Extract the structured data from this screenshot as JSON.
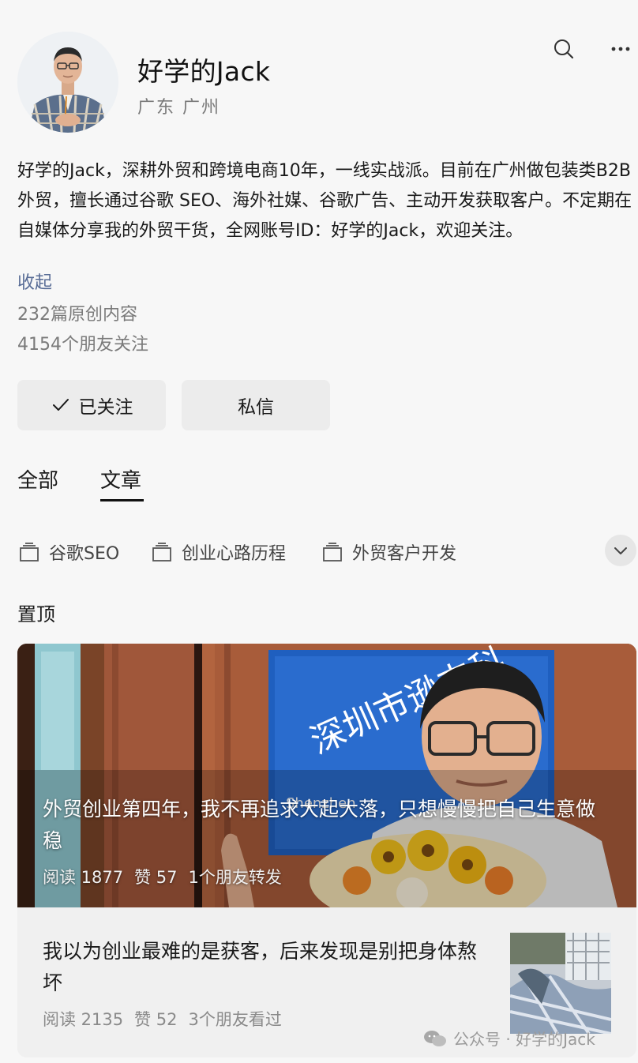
{
  "profile": {
    "name": "好学的Jack",
    "location": "广东  广州",
    "bio": "好学的Jack，深耕外贸和跨境电商10年，一线实战派。目前在广州做包装类B2B外贸，擅长通过谷歌 SEO、海外社媒、谷歌广告、主动开发获取客户。不定期在自媒体分享我的外贸干货，全网账号ID：好学的Jack，欢迎关注。",
    "collapse_label": "收起",
    "original_count": "232篇原创内容",
    "friends_following": "4154个朋友关注"
  },
  "header_icons": [
    "search-icon",
    "more-icon"
  ],
  "actions": {
    "follow_label": "已关注",
    "message_label": "私信"
  },
  "tabs": [
    {
      "label": "全部",
      "active": false
    },
    {
      "label": "文章",
      "active": true
    }
  ],
  "collections": [
    {
      "label": "谷歌SEO",
      "icon": "collection-icon"
    },
    {
      "label": "创业心路历程",
      "icon": "collection-icon"
    },
    {
      "label": "外贸客户开发",
      "icon": "collection-icon"
    }
  ],
  "pinned": {
    "label": "置顶",
    "cover_article": {
      "title": "外贸创业第四年，我不再追求大起大落，只想慢慢把自己生意做稳",
      "reads": "阅读 1877",
      "likes": "赞 57",
      "shares": "1个朋友转发",
      "sign_text": "深圳市逊杰科",
      "sign_sub": "Shenzhen"
    },
    "second_article": {
      "title": "我以为创业最难的是获客，后来发现是别把身体熬坏",
      "reads": "阅读 2135",
      "likes": "赞 52",
      "viewed": "3个朋友看过"
    }
  },
  "watermark": "公众号 · 好学的Jack",
  "colors": {
    "link": "#576b95",
    "background": "#f7f7f7",
    "button": "#ececec",
    "sign_blue": "#1f5fbf"
  }
}
